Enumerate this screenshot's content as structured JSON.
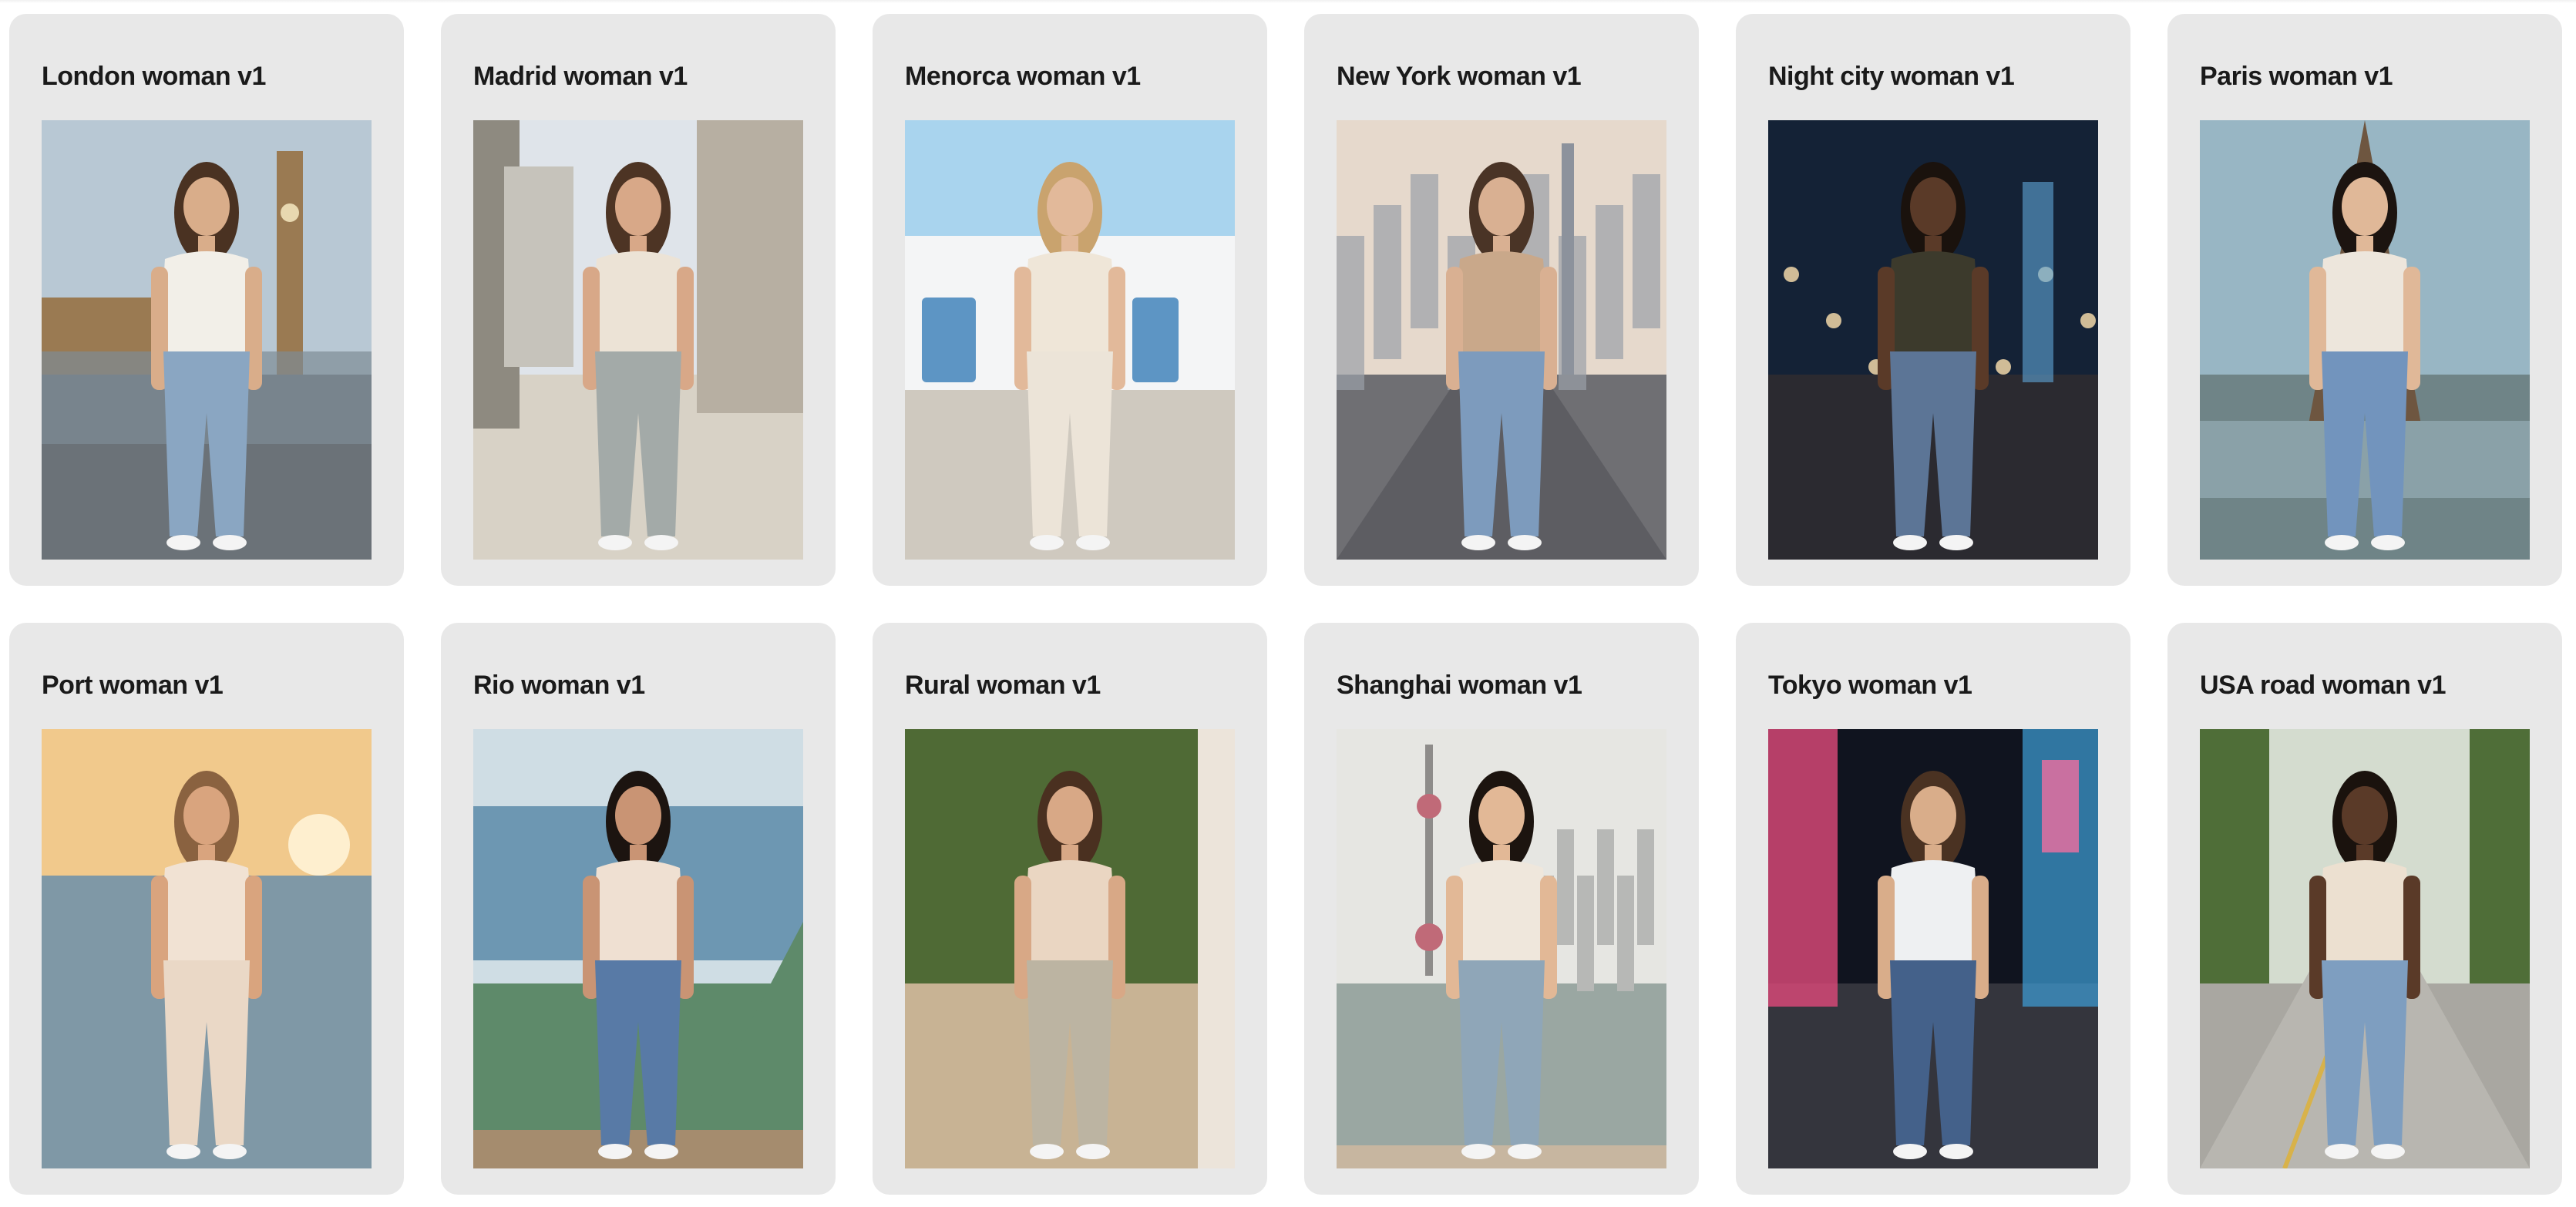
{
  "gallery": {
    "cards": [
      {
        "title": "London woman v1",
        "scene": "london",
        "colors": {
          "sky": "#b8c8d4",
          "ground": "#6b7278",
          "accent": "#9a7a52",
          "top": "#f2efe8",
          "bottom": "#8aa6c2",
          "skin": "#d9ad8a",
          "hair": "#4a3222"
        }
      },
      {
        "title": "Madrid woman v1",
        "scene": "madrid",
        "colors": {
          "sky": "#dfe4ea",
          "ground": "#d8d2c6",
          "accent": "#8e8a80",
          "top": "#ece3d6",
          "bottom": "#a3aaa8",
          "skin": "#d8a888",
          "hair": "#4d3424"
        }
      },
      {
        "title": "Menorca woman v1",
        "scene": "menorca",
        "colors": {
          "sky": "#a9d4ee",
          "ground": "#cfc9bf",
          "accent": "#5d95c4",
          "top": "#efe6d8",
          "bottom": "#ece4d8",
          "skin": "#e2b99a",
          "hair": "#c9a36e"
        }
      },
      {
        "title": "New York woman v1",
        "scene": "newyork",
        "colors": {
          "sky": "#e6d9cc",
          "ground": "#6f6f73",
          "accent": "#9aa0a8",
          "top": "#c9a88a",
          "bottom": "#7d9bbd",
          "skin": "#d9b092",
          "hair": "#4a3426"
        }
      },
      {
        "title": "Night city woman v1",
        "scene": "night",
        "colors": {
          "sky": "#142236",
          "ground": "#2b2a30",
          "accent": "#5fa6d8",
          "top": "#3c3a2c",
          "bottom": "#5c7596",
          "skin": "#5a3a28",
          "hair": "#1a120d"
        }
      },
      {
        "title": "Paris woman v1",
        "scene": "paris",
        "colors": {
          "sky": "#98b6c4",
          "ground": "#6f8487",
          "accent": "#6e5640",
          "top": "#ede6dc",
          "bottom": "#7294bd",
          "skin": "#e0b898",
          "hair": "#1c1410"
        }
      },
      {
        "title": "Port woman v1",
        "scene": "port",
        "colors": {
          "sky": "#f1c98c",
          "ground": "#7f98a6",
          "accent": "#e6a85e",
          "top": "#f1e2d3",
          "bottom": "#ead8c6",
          "skin": "#d9a47e",
          "hair": "#8a6240"
        }
      },
      {
        "title": "Rio woman v1",
        "scene": "rio",
        "colors": {
          "sky": "#cfdde4",
          "ground": "#5e8a6a",
          "accent": "#6d97b2",
          "top": "#efe0d2",
          "bottom": "#587aa6",
          "skin": "#c99474",
          "hair": "#1c1410"
        }
      },
      {
        "title": "Rural woman v1",
        "scene": "rural",
        "colors": {
          "sky": "#7e8f5a",
          "ground": "#c8b394",
          "accent": "#4f6a35",
          "top": "#ead6c2",
          "bottom": "#bcb4a2",
          "skin": "#d8a886",
          "hair": "#4a3020"
        }
      },
      {
        "title": "Shanghai woman v1",
        "scene": "shanghai",
        "colors": {
          "sky": "#e6e6e2",
          "ground": "#9aa7a2",
          "accent": "#b7b8b6",
          "top": "#efe7dc",
          "bottom": "#8fa6b8",
          "skin": "#e2b896",
          "hair": "#1c140f"
        }
      },
      {
        "title": "Tokyo woman v1",
        "scene": "tokyo",
        "colors": {
          "sky": "#10141f",
          "ground": "#34353d",
          "accent": "#e04a7a",
          "top": "#eef0f2",
          "bottom": "#44618a",
          "skin": "#d9ad8a",
          "hair": "#4a3222"
        }
      },
      {
        "title": "USA road woman v1",
        "scene": "usaroad",
        "colors": {
          "sky": "#d4dccf",
          "ground": "#a9a7a1",
          "accent": "#4f6e38",
          "top": "#ece0d0",
          "bottom": "#7e9ec0",
          "skin": "#5a3a28",
          "hair": "#1a120d"
        }
      }
    ]
  }
}
